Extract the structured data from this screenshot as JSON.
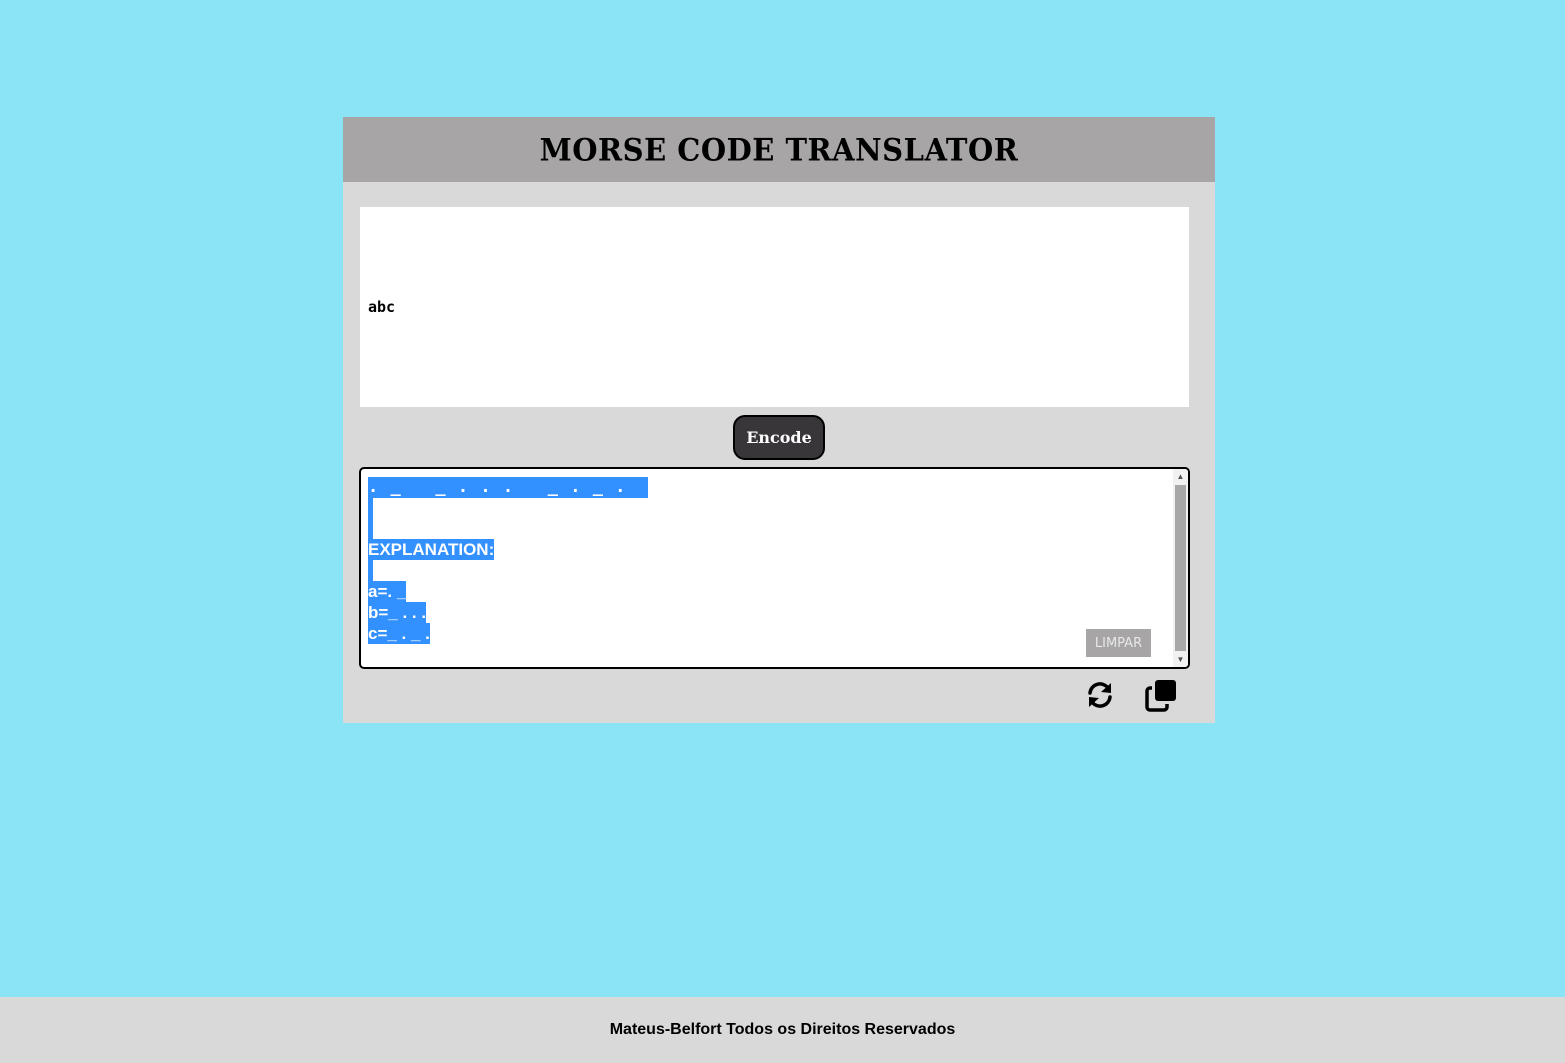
{
  "header": {
    "title": "MORSE CODE TRANSLATOR"
  },
  "input": {
    "value": "abc"
  },
  "encode_button": {
    "label": "Encode"
  },
  "output": {
    "morse": ". _   _ . . .   _ . _ .",
    "explanation_heading": "EXPLANATION:",
    "explanation_lines": [
      "a=. _",
      "b=_ . . .",
      "c=_ . _ ."
    ],
    "clear_label": "LIMPAR",
    "selection_color": "#3390ff"
  },
  "actions": {
    "swap_icon": "swap-icon",
    "copy_icon": "copy-icon"
  },
  "footer": {
    "text": "Mateus-Belfort Todos os Direitos Reservados"
  },
  "colors": {
    "background": "#8ae4f6",
    "panel": "#d9d9d9",
    "header": "#a7a5a6",
    "button": "#383638"
  }
}
